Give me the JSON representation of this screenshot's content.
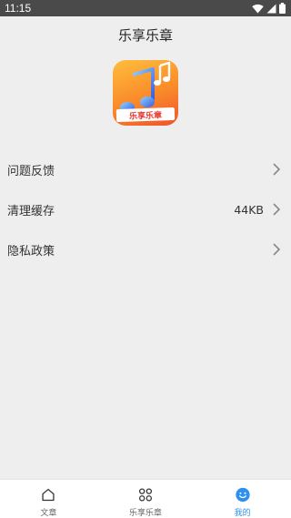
{
  "status_bar": {
    "time": "11:15",
    "icons": [
      "wifi-icon",
      "signal-icon",
      "battery-icon"
    ]
  },
  "header": {
    "title": "乐享乐章"
  },
  "logo": {
    "banner_text": "乐享乐章",
    "icon": "music-notes-icon"
  },
  "menu": {
    "items": [
      {
        "label": "问题反馈",
        "value": "",
        "icon": "chevron-right-icon"
      },
      {
        "label": "清理缓存",
        "value": "44KB",
        "icon": "chevron-right-icon"
      },
      {
        "label": "隐私政策",
        "value": "",
        "icon": "chevron-right-icon"
      }
    ]
  },
  "tabs": [
    {
      "label": "文章",
      "icon": "home-icon",
      "active": false
    },
    {
      "label": "乐享乐章",
      "icon": "grid-clover-icon",
      "active": false
    },
    {
      "label": "我的",
      "icon": "smiley-icon",
      "active": true
    }
  ],
  "colors": {
    "accent": "#2d8ff0",
    "background": "#eeeeee",
    "status_bar": "#4a4a4a",
    "logo_gradient": [
      "#ffbe3d",
      "#f98a2a",
      "#f0532a"
    ]
  }
}
